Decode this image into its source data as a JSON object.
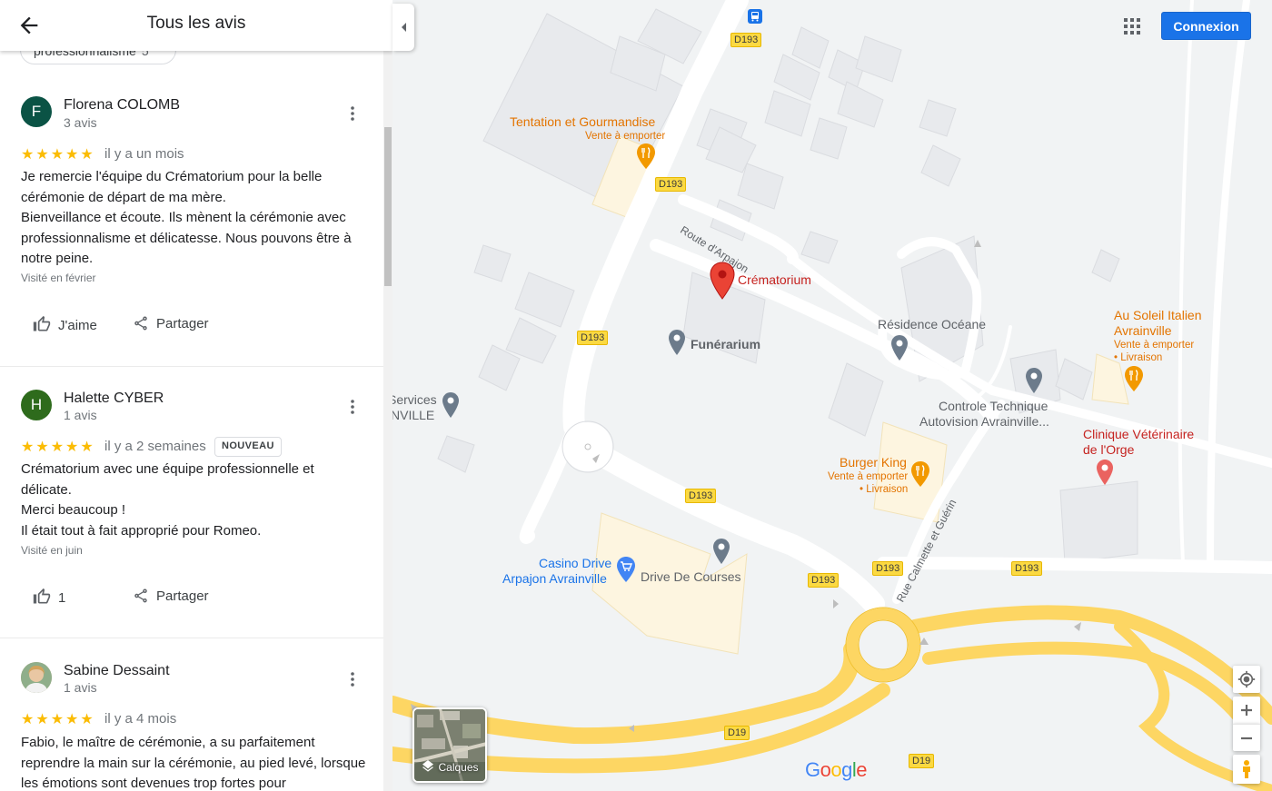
{
  "panel": {
    "title": "Tous les avis",
    "filter_chip": {
      "label": "professionnalisme",
      "count": "5"
    }
  },
  "reviews": [
    {
      "avatar_letter": "F",
      "avatar_color": "#0b5345",
      "name": "Florena COLOMB",
      "count": "3 avis",
      "stars": "★★★★★",
      "date": "il y a un mois",
      "badge": "",
      "text": "Je remercie l'équipe du Crématorium pour la belle cérémonie de départ de ma mère.\nBienveillance et  écoute. Ils mènent la cérémonie avec professionnalisme et délicatesse. Nous pouvons être à notre peine.",
      "visited": "Visité en février",
      "like_label": "J'aime",
      "share_label": "Partager"
    },
    {
      "avatar_letter": "H",
      "avatar_color": "#2e6b1c",
      "name": "Halette CYBER",
      "count": "1 avis",
      "stars": "★★★★★",
      "date": "il y a 2 semaines",
      "badge": "NOUVEAU",
      "text": "Crématorium avec une équipe professionnelle et délicate.\nMerci beaucoup !\nIl était tout à fait approprié pour Romeo.",
      "visited": "Visité en juin",
      "like_label": "1",
      "share_label": "Partager"
    },
    {
      "avatar_letter": "",
      "avatar_color": "#c9a27a",
      "name": "Sabine Dessaint",
      "count": "1 avis",
      "stars": "★★★★★",
      "date": "il y a 4 mois",
      "badge": "",
      "text": "Fabio, le maître de cérémonie, a su parfaitement reprendre la main sur la cérémonie, au pied levé, lorsque les émotions sont devenues trop fortes pour",
      "visited": "",
      "like_label": "",
      "share_label": ""
    }
  ],
  "map": {
    "signin_label": "Connexion",
    "layers_label": "Calques",
    "google_logo": [
      "G",
      "o",
      "o",
      "g",
      "l",
      "e"
    ],
    "google_logo_colors": [
      "#4285f4",
      "#ea4335",
      "#fbbc05",
      "#4285f4",
      "#34a853",
      "#ea4335"
    ],
    "road_labels": [
      "D193",
      "D193",
      "D193",
      "D193",
      "D193",
      "D193",
      "D193",
      "D19",
      "D19"
    ],
    "street_labels": {
      "route_arpajon": "Route d'Arpajon",
      "rue_calmette": "Rue Calmette et Guérin"
    },
    "pois": {
      "crematorium": "Crématorium",
      "funerarium": "Funérarium",
      "residence": "Résidence Océane",
      "tentation_name": "Tentation et Gourmandise",
      "tentation_sub": "Vente à emporter",
      "soleil_name_1": "Au Soleil Italien",
      "soleil_name_2": "Avrainville",
      "soleil_sub_1": "Vente à emporter",
      "soleil_sub_2": "• Livraison",
      "controle_1": "Controle Technique",
      "controle_2": "Autovision Avrainville...",
      "clinique_1": "Clinique Vétérinaire",
      "clinique_2": "de l'Orge",
      "burger_name": "Burger King",
      "burger_sub_1": "Vente à emporter",
      "burger_sub_2": "• Livraison",
      "services_1": "Services",
      "services_2": "NVILLE",
      "casino_1": "Casino Drive",
      "casino_2": "Arpajon Avrainville",
      "drive": "Drive De Courses"
    },
    "colors": {
      "marker_red": "#ea4335",
      "food_orange": "#e37400",
      "poi_blue": "#1a73e8",
      "poi_gray": "#5f6368"
    }
  }
}
